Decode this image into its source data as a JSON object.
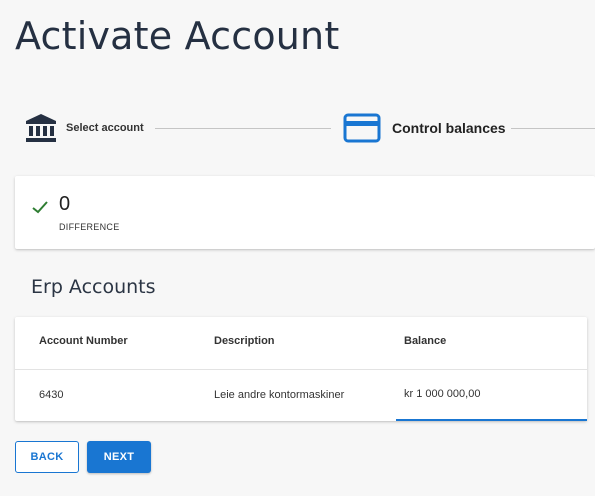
{
  "page": {
    "title": "Activate Account"
  },
  "stepper": {
    "steps": [
      {
        "label": "Select account",
        "icon": "bank-icon",
        "active": false
      },
      {
        "label": "Control balances",
        "icon": "credit-card-icon",
        "active": true
      }
    ]
  },
  "difference": {
    "value": "0",
    "label": "DIFFERENCE",
    "status_icon": "check-icon"
  },
  "erp": {
    "title": "Erp Accounts",
    "columns": [
      "Account Number",
      "Description",
      "Balance"
    ],
    "rows": [
      {
        "account_number": "6430",
        "description": "Leie andre kontormaskiner",
        "balance": "kr 1 000 000,00"
      }
    ]
  },
  "actions": {
    "back_label": "BACK",
    "next_label": "NEXT"
  },
  "colors": {
    "accent": "#1976d2",
    "success": "#2e7d32",
    "title": "#253042"
  }
}
